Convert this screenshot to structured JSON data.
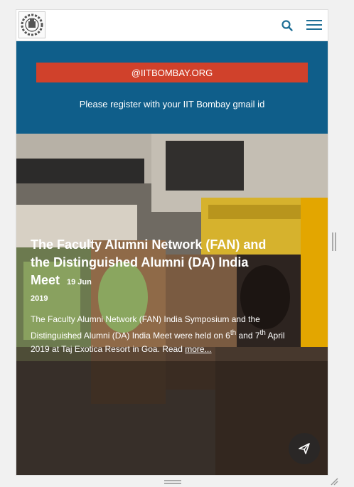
{
  "header": {
    "logo_icon": "iitb-logo-icon",
    "search_icon": "search-icon",
    "menu_icon": "hamburger-menu-icon"
  },
  "banner": {
    "button_label": "@IITBOMBAY.ORG",
    "note": "Please register with your IIT Bombay gmail id"
  },
  "news": {
    "title": "The Faculty Alumni Network (FAN) and the Distinguished Alumni (DA) India Meet",
    "date": "19 Jun",
    "year": "2019",
    "desc_part1": "The Faculty Alumni Network (FAN) India Symposium and the Distinguished Alumni (DA) India Meet were held on 6",
    "sup1": "th",
    "desc_part2": " and 7",
    "sup2": "th",
    "desc_part3": " April 2019 at Taj Exotica Resort in Goa.  Read ",
    "more_label": "more..."
  },
  "fab": {
    "icon": "send-icon"
  },
  "colors": {
    "banner": "#0f5e8a",
    "accent": "#d0412b"
  }
}
